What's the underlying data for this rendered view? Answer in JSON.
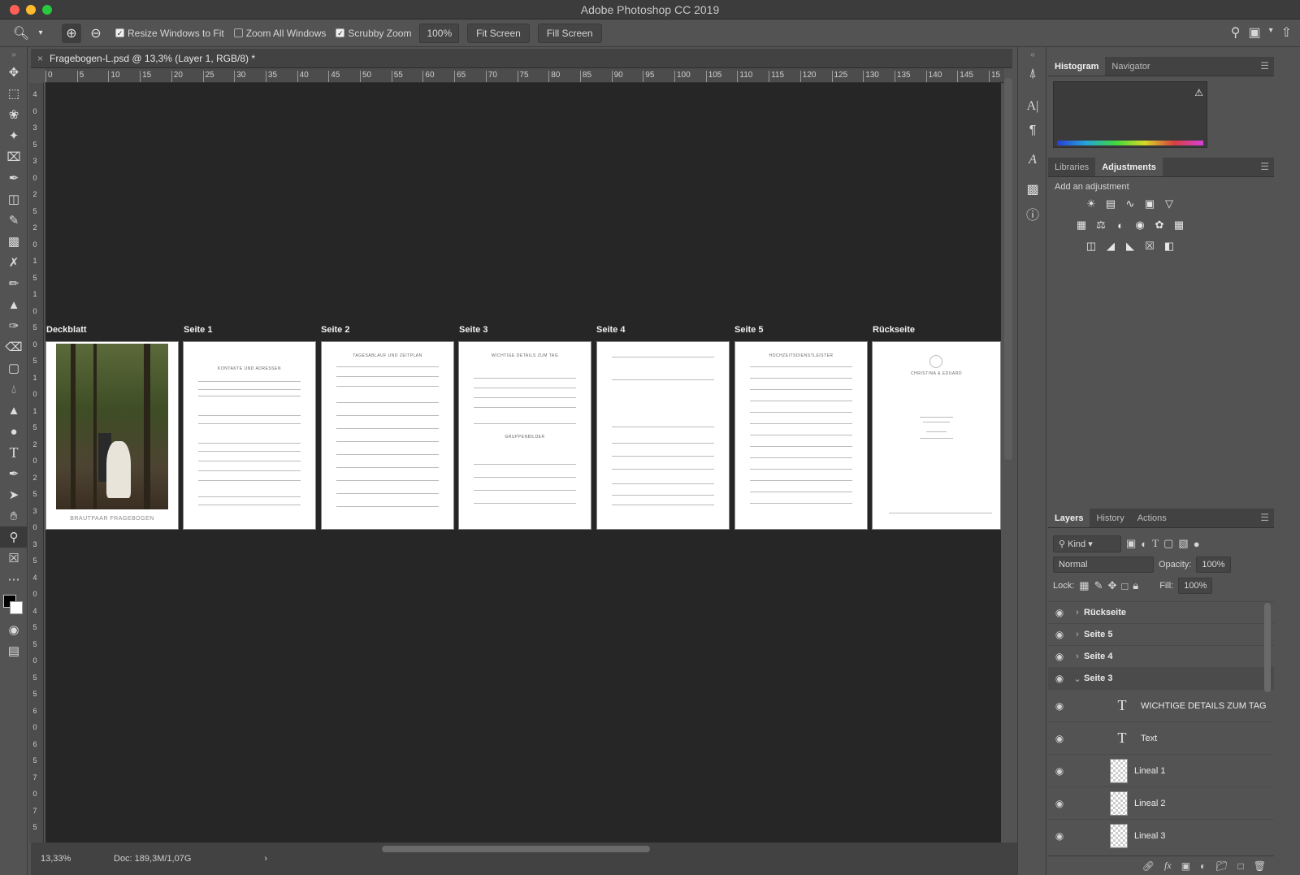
{
  "app": {
    "title": "Adobe Photoshop CC 2019"
  },
  "options_bar": {
    "resize_windows_label": "Resize Windows to Fit",
    "resize_windows_checked": true,
    "zoom_all_label": "Zoom All Windows",
    "zoom_all_checked": false,
    "scrubby_zoom_label": "Scrubby Zoom",
    "scrubby_zoom_checked": true,
    "zoom_value": "100%",
    "fit_screen_label": "Fit Screen",
    "fill_screen_label": "Fill Screen"
  },
  "document": {
    "tab_title": "Fragebogen-L.psd @ 13,3% (Layer 1, RGB/8) *"
  },
  "ruler": {
    "h_ticks": [
      "0",
      "5",
      "10",
      "15",
      "20",
      "25",
      "30",
      "35",
      "40",
      "45",
      "50",
      "55",
      "60",
      "65",
      "70",
      "75",
      "80",
      "85",
      "90",
      "95",
      "100",
      "105",
      "110",
      "115",
      "120",
      "125",
      "130",
      "135",
      "140",
      "145",
      "15"
    ],
    "v_ticks": [
      "4",
      "0",
      "3",
      "5",
      "3",
      "0",
      "2",
      "5",
      "2",
      "0",
      "1",
      "5",
      "1",
      "0",
      "5",
      "0",
      "5",
      "1",
      "0",
      "1",
      "5",
      "2",
      "0",
      "2",
      "5",
      "3",
      "0",
      "3",
      "5",
      "4",
      "0",
      "4",
      "5",
      "5",
      "0",
      "5",
      "5",
      "6",
      "0",
      "6",
      "5",
      "7",
      "0",
      "7",
      "5"
    ]
  },
  "artboards": [
    {
      "label": "Deckblatt",
      "caption": "BRAUTPAAR FRAGEBOGEN"
    },
    {
      "label": "Seite 1",
      "heading": "KONTAKTE UND ADRESSEN"
    },
    {
      "label": "Seite 2",
      "heading": "TAGESABLAUF UND ZEITPLAN"
    },
    {
      "label": "Seite 3",
      "heading": "WICHTIGE DETAILS ZUM TAG",
      "subheading": "GRUPPENBILDER"
    },
    {
      "label": "Seite 4"
    },
    {
      "label": "Seite 5",
      "heading": "HOCHZEITSDIENSTLEISTER"
    },
    {
      "label": "Rückseite",
      "brand": "CHRISTINA & EDUARD"
    }
  ],
  "status": {
    "zoom": "13,33%",
    "doc": "Doc: 189,3M/1,07G",
    "arrow": "›"
  },
  "panels": {
    "top_tabs": [
      "Histogram",
      "Navigator"
    ],
    "mid_tabs": [
      "Libraries",
      "Adjustments"
    ],
    "adjustments_hint": "Add an adjustment",
    "layers_tabs": [
      "Layers",
      "History",
      "Actions"
    ],
    "filter_kind": "Kind",
    "blend_mode": "Normal",
    "opacity_label": "Opacity:",
    "opacity_value": "100%",
    "lock_label": "Lock:",
    "fill_label": "Fill:",
    "fill_value": "100%"
  },
  "layers": [
    {
      "name": "Rückseite",
      "type": "group",
      "expanded": false
    },
    {
      "name": "Seite 5",
      "type": "group",
      "expanded": false
    },
    {
      "name": "Seite 4",
      "type": "group",
      "expanded": false
    },
    {
      "name": "Seite 3",
      "type": "group",
      "expanded": true
    },
    {
      "name": "WICHTIGE DETAILS ZUM TAG",
      "type": "text"
    },
    {
      "name": "Text",
      "type": "text"
    },
    {
      "name": "Lineal 1",
      "type": "pixel"
    },
    {
      "name": "Lineal 2",
      "type": "pixel"
    },
    {
      "name": "Lineal 3",
      "type": "pixel"
    }
  ],
  "colors": {
    "canvas": "#262626",
    "ui": "#535353",
    "close": "#ff5f57",
    "minimize": "#febc2e",
    "zoom": "#28c840"
  }
}
